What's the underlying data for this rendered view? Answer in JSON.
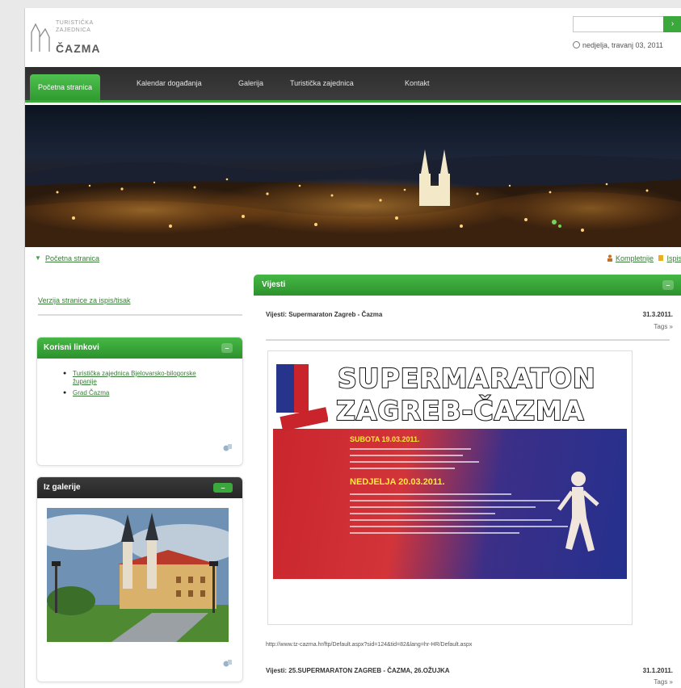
{
  "header": {
    "logo_small_1": "TURISTIČKA",
    "logo_small_2": "ZAJEDNICA",
    "logo_name": "ČAZMA",
    "search_placeholder": "",
    "search_button": "›",
    "date": "nedjelja, travanj 03, 2011"
  },
  "nav": {
    "items": [
      "Početna stranica",
      "Kalendar događanja",
      "Galerija",
      "Turistička zajednica",
      "Kontakt"
    ]
  },
  "breadcrumb": {
    "current": "Početna stranica",
    "actions": [
      "Kompletnije",
      "Ispis"
    ]
  },
  "left": {
    "top_link": "Verzija stranice za ispis/tisak",
    "links_box": {
      "title": "Korisni linkovi",
      "items": [
        "Turistička zajednica Bjelovarsko-bilogorske županije",
        "Grad Čazma"
      ]
    },
    "gallery_box": {
      "title": "Iz galerije"
    }
  },
  "main": {
    "section_title": "Vijesti",
    "news": [
      {
        "title": "Vijesti: Supermaraton Zagreb - Čazma",
        "date": "31.3.2011.",
        "more": "Tags »"
      },
      {
        "title": "Vijesti: 25.SUPERMARATON ZAGREB - ČAZMA, 26.OŽUJKA",
        "date": "31.1.2011.",
        "more": "Tags »"
      }
    ],
    "poster": {
      "line1": "SUPERMARATON",
      "line2": "ZAGREB-ČAZMA",
      "sub1": "SUBOTA 19.03.2011.",
      "sub2": "NEDJELJA 20.03.2011."
    },
    "url": "http://www.tz-cazma.hr/ftp/Default.aspx?sid=124&tid=82&lang=hr-HR/Default.aspx"
  },
  "colors": {
    "accent": "#3aa83a",
    "nav_bg": "#2e2e2e",
    "link": "#3c7a3c"
  }
}
